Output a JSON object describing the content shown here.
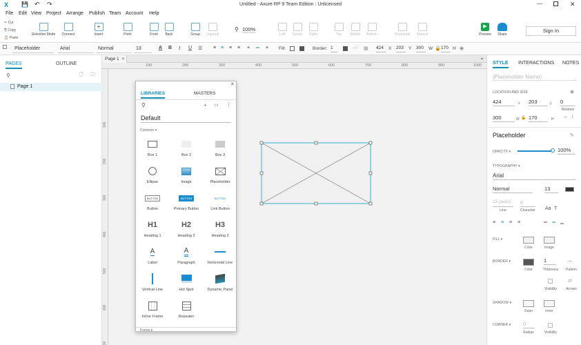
{
  "window": {
    "title": "Untitled - Axure RP 9 Team Edition : Unlicensed",
    "app_icon": "axure-x-icon"
  },
  "menus": [
    "File",
    "Edit",
    "View",
    "Project",
    "Arrange",
    "Publish",
    "Team",
    "Account",
    "Help"
  ],
  "edit_actions": {
    "cut": "Cut",
    "copy": "Copy",
    "paste": "Paste"
  },
  "toolbar": {
    "selection_mode": "Selection Mode",
    "connect": "Connect",
    "insert": "Insert",
    "point": "Point",
    "front": "Front",
    "back": "Back",
    "group": "Group",
    "ungroup": "Ungroup",
    "zoom": "100%",
    "left": "Left",
    "center": "Center",
    "right": "Right",
    "top": "Top",
    "middle": "Middle",
    "bottom": "Bottom",
    "horizontal": "Horizontal",
    "vertical": "Vertical",
    "preview": "Preview",
    "share": "Share",
    "sign_in": "Sign In"
  },
  "formatbar": {
    "style": "Placeholder",
    "font": "Arial",
    "weight": "Normal",
    "size": "13",
    "fill_label": "Fill:",
    "border_label": "Border:",
    "border_value": "1",
    "x": "424",
    "x_label": "X",
    "y": "203",
    "y_label": "Y",
    "w": "300",
    "w_label": "W",
    "h": "170",
    "h_label": "H"
  },
  "leftpanel": {
    "tabs": [
      "PAGES",
      "OUTLINE"
    ],
    "pages": [
      "Page 1"
    ]
  },
  "canvas": {
    "tab": "Page 1",
    "ruler_top": [
      "100",
      "200",
      "300",
      "400",
      "500",
      "600",
      "700",
      "800",
      "900",
      "1000"
    ],
    "ruler_left": [
      "100",
      "200",
      "300",
      "400",
      "500",
      "600",
      "700"
    ]
  },
  "libraries": {
    "tabs": [
      "LIBRARIES",
      "MASTERS"
    ],
    "current": "Default",
    "section_common": "Common ▾",
    "section_forms": "Forms ▾",
    "items": [
      {
        "label": "Box 1"
      },
      {
        "label": "Box 2"
      },
      {
        "label": "Box 3"
      },
      {
        "label": "Ellipse"
      },
      {
        "label": "Image"
      },
      {
        "label": "Placeholder"
      },
      {
        "label": "Button",
        "glyph": "BUTTON"
      },
      {
        "label": "Primary Button",
        "glyph": "BUTTON"
      },
      {
        "label": "Link Button",
        "glyph": "BUTTON"
      },
      {
        "label": "Heading 1",
        "glyph": "H1"
      },
      {
        "label": "Heading 2",
        "glyph": "H2"
      },
      {
        "label": "Heading 3",
        "glyph": "H3"
      },
      {
        "label": "Label",
        "glyph": "A_"
      },
      {
        "label": "Paragraph",
        "glyph": "A"
      },
      {
        "label": "Horizontal Line"
      },
      {
        "label": "Vertical Line"
      },
      {
        "label": "Hot Spot"
      },
      {
        "label": "Dynamic Panel"
      },
      {
        "label": "Inline Frame"
      },
      {
        "label": "Repeater"
      }
    ]
  },
  "rightpanel": {
    "tabs": [
      "STYLE",
      "INTERACTIONS",
      "NOTES"
    ],
    "name_placeholder": "(Placeholder Name)",
    "location_size": "LOCATION AND SIZE",
    "x": "424",
    "y": "203",
    "rotation": "0",
    "rotation_label": "Rotation",
    "w": "300",
    "h": "170",
    "x_label": "x",
    "y_label": "y",
    "w_label": "W",
    "h_label": "H",
    "style_name": "Placeholder",
    "opacity_label": "OPACITY ▾",
    "opacity": "100%",
    "typography_label": "TYPOGRAPHY ▾",
    "font": "Arial",
    "weight": "Normal",
    "size": "13",
    "line_placeholder": "15 (auto)",
    "line": "Line",
    "character_value": "0",
    "character": "Character",
    "fill_label": "FILL ▾",
    "fill_color": "Color",
    "fill_image": "Image",
    "border_label": "BORDER ▾",
    "border_color": "Color",
    "border_thickness": "1",
    "thickness": "Thickness",
    "pattern": "Pattern",
    "visibility": "Visibility",
    "arrows": "Arrows",
    "shadow_label": "SHADOW ▾",
    "outer": "Outer",
    "inner": "Inner",
    "corner_label": "CORNER ▾",
    "corner_radius": "0",
    "radius": "Radius",
    "corner_visibility": "Visibility"
  },
  "colors": {
    "accent": "#0b8fb3",
    "selection": "#33b3cc",
    "page_row_bg": "#e3f3f8"
  }
}
